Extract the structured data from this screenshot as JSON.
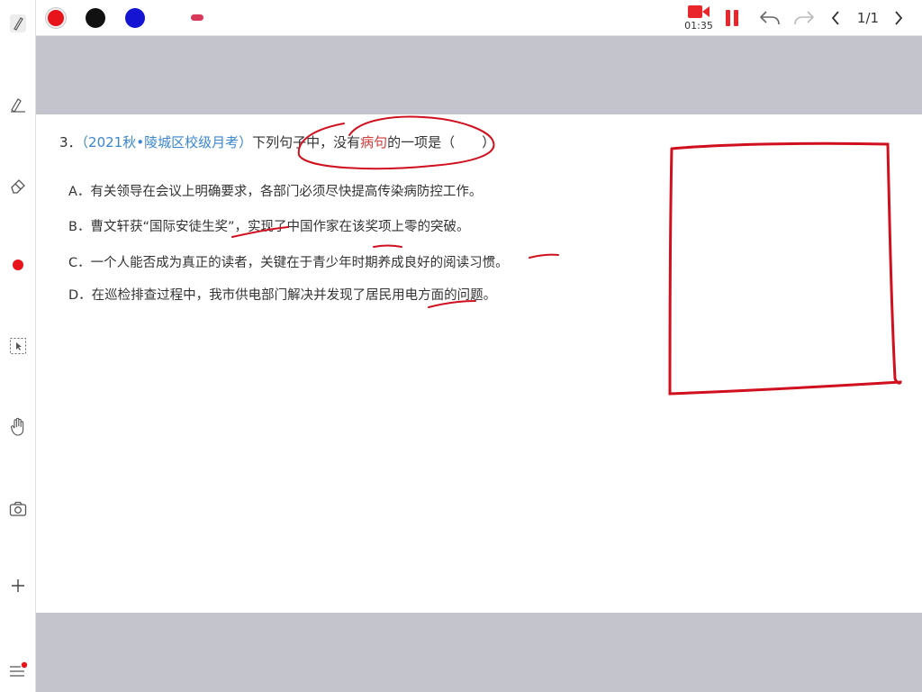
{
  "toolbar": {
    "colors": [
      "#e8141b",
      "#111111",
      "#1414d2"
    ],
    "pen_size_color": "#d9385a",
    "timer": "01:35",
    "page_indicator": "1/1"
  },
  "sidebar": {
    "icons": [
      "pen-icon",
      "highlighter-icon",
      "eraser-icon",
      "red-dot-icon",
      "select-icon",
      "hand-icon",
      "camera-icon",
      "plus-icon",
      "menu-icon"
    ]
  },
  "question": {
    "number": "3．",
    "source": "（2021秋•陵城区校级月考）",
    "stem_before": "下列句子中，没有",
    "stem_highlight": "病句",
    "stem_after": "的一项是（　　）",
    "options": [
      "A．有关领导在会议上明确要求，各部门必须尽快提高传染病防控工作。",
      "B．曹文轩获“国际安徒生奖”，实现了中国作家在该奖项上零的突破。",
      "C．一个人能否成为真正的读者，关键在于青少年时期养成良好的阅读习惯。",
      "D．在巡检排查过程中，我市供电部门解决并发现了居民用电方面的问题。"
    ]
  },
  "annotation_color": "#d0101e"
}
